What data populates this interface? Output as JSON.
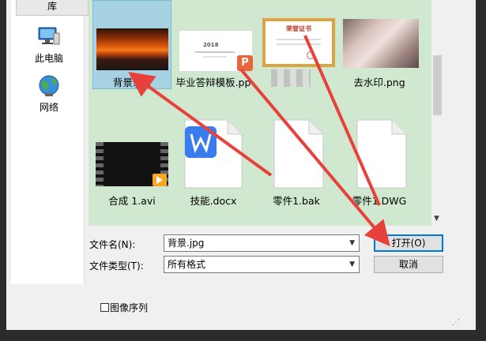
{
  "nav": {
    "library_label": "库",
    "items": [
      {
        "label": "此电脑",
        "icon": "computer-icon"
      },
      {
        "label": "网络",
        "icon": "network-icon"
      }
    ]
  },
  "files": [
    {
      "name": "背景.jpg",
      "type": "image",
      "selected": true
    },
    {
      "name": "毕业答辩模板.pptx",
      "type": "pptx"
    },
    {
      "name": "",
      "type": "image"
    },
    {
      "name": "去水印.png",
      "type": "image"
    },
    {
      "name": "合成 1.avi",
      "type": "video"
    },
    {
      "name": "技能.docx",
      "type": "docx"
    },
    {
      "name": "零件1.bak",
      "type": "generic"
    },
    {
      "name": "零件1.DWG",
      "type": "generic"
    }
  ],
  "file_captions": {
    "f0": "背景.jpg",
    "f1": "毕业答辩模板.pp",
    "f3": "去水印.png",
    "f4": "合成 1.avi",
    "f5": "技能.docx",
    "f6": "零件1.bak",
    "f7": "零件1.DWG"
  },
  "slide_year": "2018",
  "cert_title": "荣誉证书",
  "filename": {
    "label": "文件名(N):",
    "value": "背景.jpg"
  },
  "filetype": {
    "label": "文件类型(T):",
    "value": "所有格式"
  },
  "buttons": {
    "open": "打开(O)",
    "cancel": "取消"
  },
  "image_sequence": {
    "label": "图像序列",
    "checked": false
  },
  "colors": {
    "file_area_bg": "#cfe8cf",
    "selection": "#a6d2e3",
    "arrow": "#e8403a",
    "pptx_badge": "#e8663a",
    "wps_blue": "#3a7bf0"
  }
}
